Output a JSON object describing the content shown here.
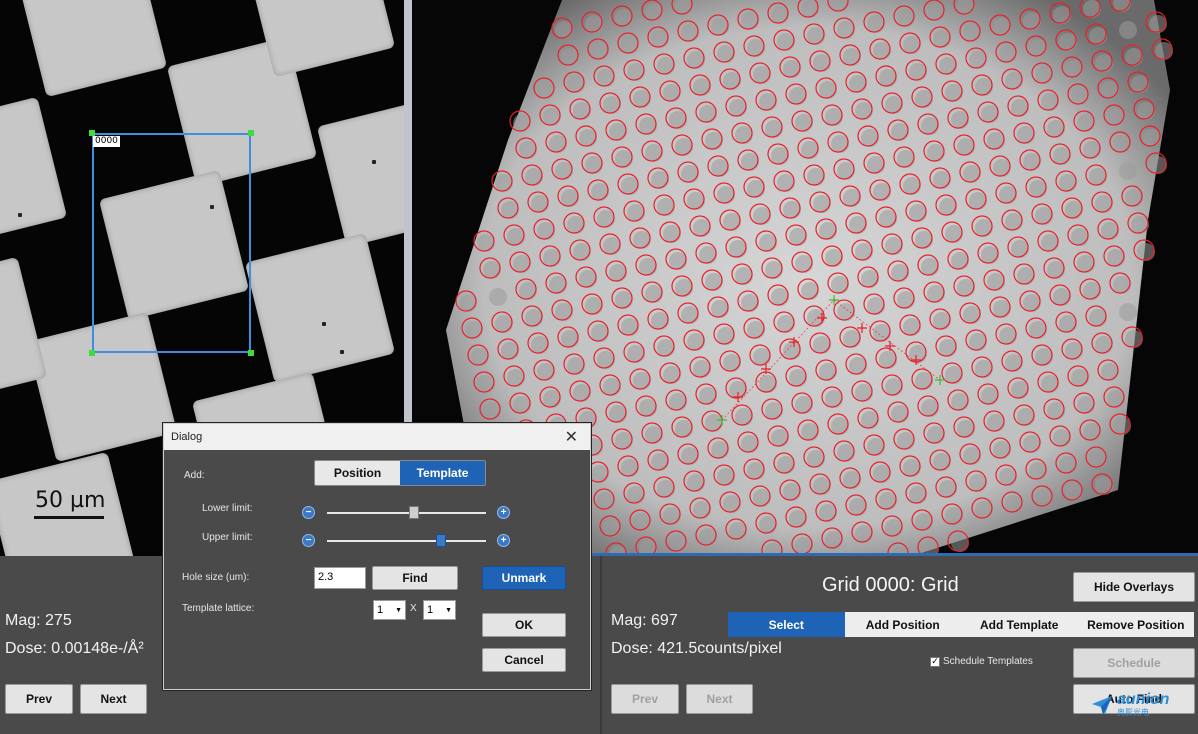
{
  "left_view": {
    "selection_label": "0000",
    "scale_bar_label": "50 µm"
  },
  "left_panel": {
    "mag": "Mag: 275",
    "dose": "Dose: 0.00148e-/Å²",
    "prev_label": "Prev",
    "next_label": "Next"
  },
  "right_panel": {
    "title": "Grid 0000: Grid",
    "hide_overlays_label": "Hide Overlays",
    "mag": "Mag: 697",
    "dose": "Dose: 421.5counts/pixel",
    "tabs": [
      "Select",
      "Add Position",
      "Add Template",
      "Remove Position"
    ],
    "active_tab": "Select",
    "schedule_templates_label": "Schedule Templates",
    "schedule_templates_checked": true,
    "schedule_label": "Schedule",
    "auto_find_label": "Auto Find",
    "prev_label": "Prev",
    "next_label": "Next"
  },
  "dialog": {
    "title": "Dialog",
    "close_glyph": "✕",
    "add_label": "Add:",
    "add_options": [
      "Position",
      "Template"
    ],
    "add_selected": "Template",
    "lower_limit_label": "Lower limit:",
    "lower_limit_value": 0.55,
    "upper_limit_label": "Upper limit:",
    "upper_limit_value": 0.72,
    "hole_size_label": "Hole size (um):",
    "hole_size_value": "2.3",
    "find_label": "Find",
    "unmark_label": "Unmark",
    "template_lattice_label": "Template lattice:",
    "lattice_rows": "1",
    "lattice_cols": "1",
    "lattice_separator": "X",
    "ok_label": "OK",
    "cancel_label": "Cancel"
  },
  "watermark": {
    "brand": "aunion",
    "sub": "奥影光电"
  },
  "colors": {
    "accent_blue": "#1e63b6",
    "selection_box": "#3f8fe0",
    "hole_marker": "#e8202a",
    "template_marker": "#3bbf3b"
  }
}
